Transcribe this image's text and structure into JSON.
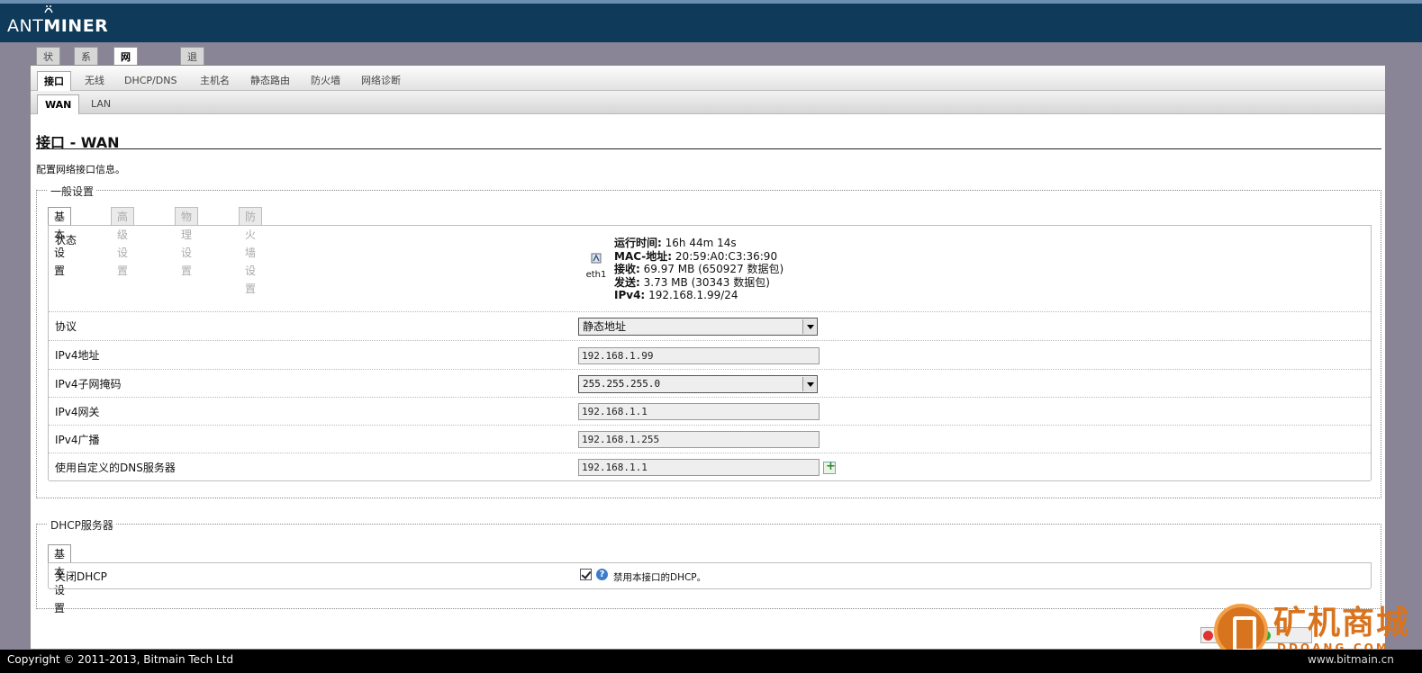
{
  "brand": {
    "logo_light": "ANT",
    "logo_bold": "MINER"
  },
  "top_tabs": [
    {
      "label": "状态",
      "active": false
    },
    {
      "label": "系统",
      "active": false
    },
    {
      "label": "网络",
      "active": true
    },
    {
      "label": "退出",
      "active": false
    }
  ],
  "sub_tabs": [
    {
      "label": "接口",
      "active": true
    },
    {
      "label": "无线",
      "active": false
    },
    {
      "label": "DHCP/DNS",
      "active": false
    },
    {
      "label": "主机名",
      "active": false
    },
    {
      "label": "静态路由",
      "active": false
    },
    {
      "label": "防火墙",
      "active": false
    },
    {
      "label": "网络诊断",
      "active": false
    }
  ],
  "iface_tabs": [
    {
      "label": "WAN",
      "active": true
    },
    {
      "label": "LAN",
      "active": false
    }
  ],
  "page": {
    "title": "接口 - WAN",
    "description": "配置网络接口信息。"
  },
  "general": {
    "legend": "一般设置",
    "tabs": [
      {
        "label": "基本设置",
        "active": true
      },
      {
        "label": "高级设置",
        "active": false
      },
      {
        "label": "物理设置",
        "active": false
      },
      {
        "label": "防火墙设置",
        "active": false
      }
    ],
    "status": {
      "label": "状态",
      "device": "eth1",
      "uptime_label": "运行时间:",
      "uptime": "16h 44m 14s",
      "mac_label": "MAC-地址:",
      "mac": "20:59:A0:C3:36:90",
      "rx_label": "接收:",
      "rx": "69.97 MB (650927 数据包)",
      "tx_label": "发送:",
      "tx": "3.73 MB (30343 数据包)",
      "ipv4_label": "IPv4:",
      "ipv4": "192.168.1.99/24"
    },
    "fields": {
      "protocol": {
        "label": "协议",
        "value": "静态地址"
      },
      "ipv4_addr": {
        "label": "IPv4地址",
        "value": "192.168.1.99"
      },
      "netmask": {
        "label": "IPv4子网掩码",
        "value": "255.255.255.0"
      },
      "gateway": {
        "label": "IPv4网关",
        "value": "192.168.1.1"
      },
      "broadcast": {
        "label": "IPv4广播",
        "value": "192.168.1.255"
      },
      "dns": {
        "label": "使用自定义的DNS服务器",
        "value": "192.168.1.1"
      }
    }
  },
  "dhcp": {
    "legend": "DHCP服务器",
    "tab": "基本设置",
    "ignore_label": "关闭DHCP",
    "ignore_checked": true,
    "ignore_desc": "禁用本接口的DHCP。"
  },
  "footer": {
    "copyright": "Copyright © 2011-2013, Bitmain Tech Ltd"
  },
  "watermark": {
    "text": "矿机商城",
    "sub": "DDQANG.COM",
    "url": "www.bitmain.cn"
  },
  "colors": {
    "header": "#0f3a5a",
    "background": "#8a8497",
    "watermark": "#d8731e"
  }
}
